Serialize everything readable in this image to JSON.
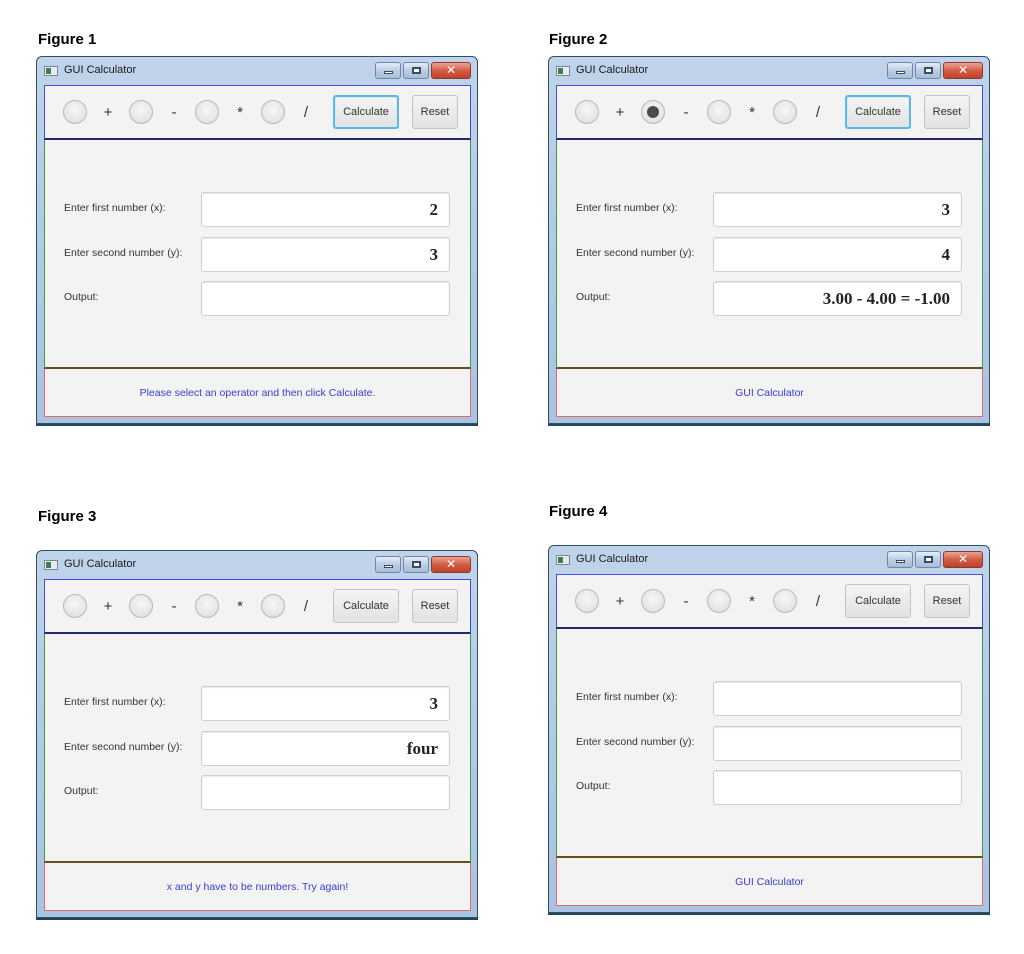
{
  "figures": [
    {
      "caption": "Figure 1",
      "window_title": "GUI Calculator",
      "operators": [
        {
          "symbol": "+",
          "selected": false
        },
        {
          "symbol": "-",
          "selected": false
        },
        {
          "symbol": "*",
          "selected": false
        },
        {
          "symbol": "/",
          "selected": false
        }
      ],
      "calculate_label": "Calculate",
      "reset_label": "Reset",
      "focused_button": "calculate",
      "first_label": "Enter first number (x):",
      "first_value": "2",
      "second_label": "Enter second number (y):",
      "second_value": "3",
      "output_label": "Output:",
      "output_value": "",
      "status": "Please select an operator and then click Calculate."
    },
    {
      "caption": "Figure 2",
      "window_title": "GUI Calculator",
      "operators": [
        {
          "symbol": "+",
          "selected": false
        },
        {
          "symbol": "-",
          "selected": true
        },
        {
          "symbol": "*",
          "selected": false
        },
        {
          "symbol": "/",
          "selected": false
        }
      ],
      "calculate_label": "Calculate",
      "reset_label": "Reset",
      "focused_button": "calculate",
      "first_label": "Enter first number (x):",
      "first_value": "3",
      "second_label": "Enter second number (y):",
      "second_value": "4",
      "output_label": "Output:",
      "output_value": "3.00 - 4.00 = -1.00",
      "status": "GUI Calculator"
    },
    {
      "caption": "Figure 3",
      "window_title": "GUI Calculator",
      "operators": [
        {
          "symbol": "+",
          "selected": false
        },
        {
          "symbol": "-",
          "selected": true
        },
        {
          "symbol": "*",
          "selected": false
        },
        {
          "symbol": "/",
          "selected": false
        }
      ],
      "calculate_label": "Calculate",
      "reset_label": "Reset",
      "focused_button": "calculate",
      "first_label": "Enter first number (x):",
      "first_value": "3",
      "second_label": "Enter second number (y):",
      "second_value": "four",
      "output_label": "Output:",
      "output_value": "",
      "status": "x and y have to be numbers. Try again!"
    },
    {
      "caption": "Figure 4",
      "window_title": "GUI Calculator",
      "operators": [
        {
          "symbol": "+",
          "selected": false
        },
        {
          "symbol": "-",
          "selected": true
        },
        {
          "symbol": "*",
          "selected": false
        },
        {
          "symbol": "/",
          "selected": false
        }
      ],
      "calculate_label": "Calculate",
      "reset_label": "Reset",
      "focused_button": "reset",
      "first_label": "Enter first number (x):",
      "first_value": "",
      "second_label": "Enter second number (y):",
      "second_value": "",
      "output_label": "Output:",
      "output_value": "",
      "status": "GUI Calculator"
    }
  ],
  "icons": {
    "app": "app-window-icon",
    "minimize": "minimize-icon",
    "maximize": "maximize-icon",
    "close": "close-icon",
    "close_glyph": "✕"
  }
}
